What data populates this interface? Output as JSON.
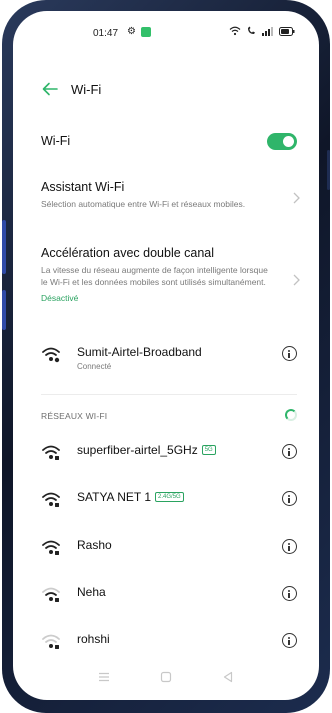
{
  "status_bar": {
    "time": "01:47",
    "icons": [
      "gear-icon",
      "app-notification-icon",
      "wifi-icon",
      "call-icon",
      "signal-icon",
      "battery-icon"
    ]
  },
  "header": {
    "title": "Wi-Fi",
    "back_icon": "back-arrow-icon"
  },
  "wifi_toggle": {
    "label": "Wi-Fi",
    "enabled": true,
    "accent": "#2fb56a"
  },
  "assistant": {
    "title": "Assistant Wi-Fi",
    "description": "Sélection automatique entre Wi-Fi et réseaux mobiles."
  },
  "dual_channel": {
    "title": "Accélération avec double canal",
    "description": "La vitesse du réseau augmente de façon intelligente lorsque le Wi-Fi et les données mobiles sont utilisés simultanément.",
    "status": "Désactivé"
  },
  "connected": {
    "name": "Sumit-Airtel-Broadband",
    "status": "Connecté"
  },
  "section": {
    "header": "RÉSEAUX WI-FI"
  },
  "networks": [
    {
      "name": "superfiber-airtel_5GHz",
      "badge": "5G"
    },
    {
      "name": "SATYA NET 1",
      "badge": "2.4G/5G"
    },
    {
      "name": "Rasho",
      "badge": ""
    },
    {
      "name": "Neha",
      "badge": ""
    },
    {
      "name": "rohshi",
      "badge": ""
    }
  ],
  "nav_icons": [
    "menu-icon",
    "home-icon",
    "back-icon"
  ]
}
